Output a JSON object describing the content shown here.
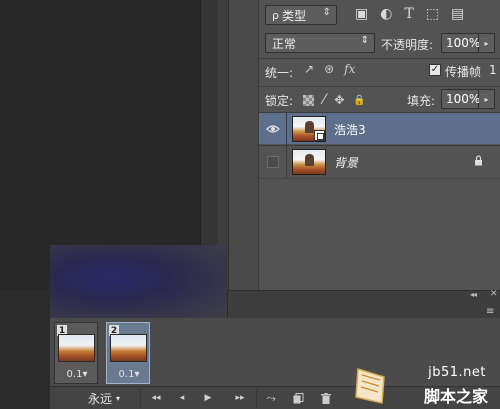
{
  "layers_panel": {
    "filter": {
      "label": "类型",
      "arrow": "⇕",
      "search_glyph": "ρ"
    },
    "filter_icons": [
      "image-filter-icon",
      "adjustment-filter-icon",
      "text-filter-icon",
      "shape-filter-icon",
      "smart-object-filter-icon"
    ],
    "filter_icon_glyphs": [
      "▣",
      "◐",
      "T",
      "⬚",
      "▤"
    ],
    "blend_mode": {
      "value": "正常",
      "arrow": "⇕"
    },
    "opacity": {
      "label": "不透明度:",
      "value": "100%",
      "arrow": "▸"
    },
    "unify": {
      "label": "统一:",
      "icons": [
        "↗",
        "⊛",
        "fx"
      ]
    },
    "propagate": {
      "label": "传播帧",
      "value": "1",
      "checked": true
    },
    "lock": {
      "label": "锁定:",
      "icons": [
        "paint-lock-icon",
        "position-lock-icon",
        "all-lock-icon"
      ],
      "glyphs": [
        "⁄",
        "✥",
        "🔒"
      ]
    },
    "fill": {
      "label": "填充:",
      "value": "100%",
      "arrow": "▸"
    },
    "layers": [
      {
        "name": "浩浩3",
        "visible": true,
        "active": true,
        "smart_object": true
      },
      {
        "name": "背景",
        "visible": false,
        "active": false,
        "locked": true
      }
    ]
  },
  "timeline": {
    "collapse_glyph": "◂◂",
    "close_glyph": "✕",
    "menu_glyph": "≡",
    "frames": [
      {
        "number": "1",
        "delay": "0.1",
        "selected": false
      },
      {
        "number": "2",
        "delay": "0.1",
        "selected": true
      }
    ],
    "delay_arrow": "▾",
    "loop": {
      "value": "永远",
      "arrow": "▾"
    },
    "controls": [
      "◂◂",
      "◂",
      "▶",
      "▸▸"
    ],
    "tools": [
      "tween-icon",
      "duplicate-frame-icon",
      "delete-frame-icon"
    ]
  },
  "watermark": {
    "site": "jb51.net",
    "text": "脚本之家"
  }
}
